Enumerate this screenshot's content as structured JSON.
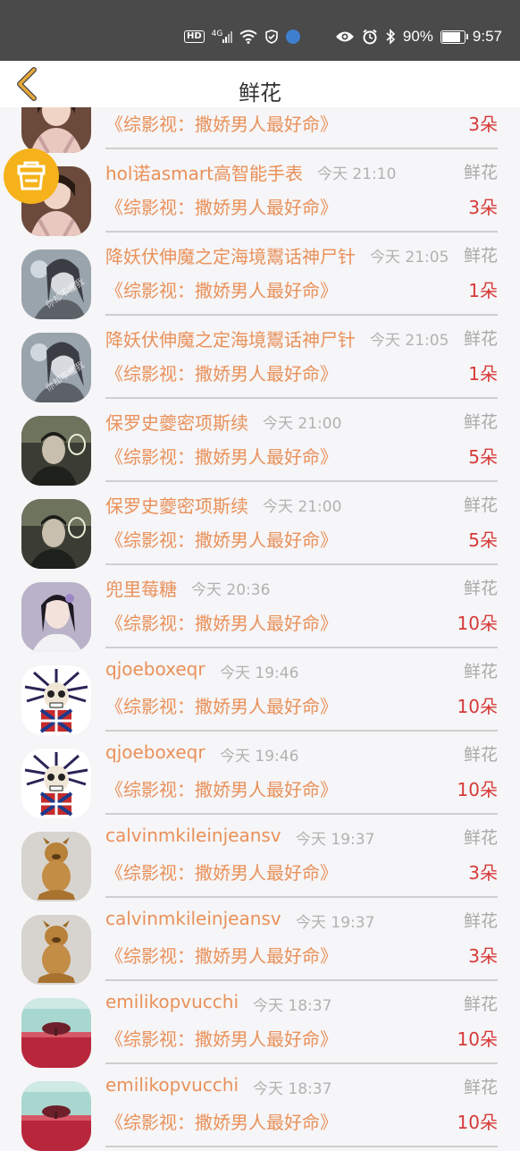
{
  "status_bar": {
    "hd": "HD",
    "network": "4G",
    "battery": "90%",
    "battery_level": 0.9,
    "time": "9:57"
  },
  "header": {
    "title": "鲜花"
  },
  "rows": [
    {
      "name": "",
      "time": "",
      "type": "",
      "work": "《综影视：撒娇男人最好命》",
      "count": "3朵",
      "avatar": "lady-portrait"
    },
    {
      "name": "hol诺asmart高智能手表",
      "time": "今天 21:10",
      "type": "鲜花",
      "work": "《综影视：撒娇男人最好命》",
      "count": "3朵",
      "avatar": "lady-portrait"
    },
    {
      "name": "降妖伏伸魔之定海境鬻话神尸针",
      "time": "今天 21:05",
      "type": "鲜花",
      "work": "《综影视：撒娇男人最好命》",
      "count": "1朵",
      "avatar": "girl-bw"
    },
    {
      "name": "降妖伏伸魔之定海境鬻话神尸针",
      "time": "今天 21:05",
      "type": "鲜花",
      "work": "《综影视：撒娇男人最好命》",
      "count": "1朵",
      "avatar": "girl-bw"
    },
    {
      "name": "保罗史夔密项斯续",
      "time": "今天 21:00",
      "type": "鲜花",
      "work": "《综影视：撒娇男人最好命》",
      "count": "5朵",
      "avatar": "man-dark"
    },
    {
      "name": "保罗史夔密项斯续",
      "time": "今天 21:00",
      "type": "鲜花",
      "work": "《综影视：撒娇男人最好命》",
      "count": "5朵",
      "avatar": "man-dark"
    },
    {
      "name": "兜里莓糖",
      "time": "今天 20:36",
      "type": "鲜花",
      "work": "《综影视：撒娇男人最好命》",
      "count": "10朵",
      "avatar": "woman-costume"
    },
    {
      "name": "qjoeboxeqr",
      "time": "今天 19:46",
      "type": "鲜花",
      "work": "《综影视：撒娇男人最好命》",
      "count": "10朵",
      "avatar": "skull-punk"
    },
    {
      "name": "qjoeboxeqr",
      "time": "今天 19:46",
      "type": "鲜花",
      "work": "《综影视：撒娇男人最好命》",
      "count": "10朵",
      "avatar": "skull-punk"
    },
    {
      "name": "calvinmkileinjeansv",
      "time": "今天 19:37",
      "type": "鲜花",
      "work": "《综影视：撒娇男人最好命》",
      "count": "3朵",
      "avatar": "dog-statue"
    },
    {
      "name": "calvinmkileinjeansv",
      "time": "今天 19:37",
      "type": "鲜花",
      "work": "《综影视：撒娇男人最好命》",
      "count": "3朵",
      "avatar": "dog-statue"
    },
    {
      "name": "emilikopvucchi",
      "time": "今天 18:37",
      "type": "鲜花",
      "work": "《综影视：撒娇男人最好命》",
      "count": "10朵",
      "avatar": "tree-field"
    },
    {
      "name": "emilikopvucchi",
      "time": "今天 18:37",
      "type": "鲜花",
      "work": "《综影视：撒娇男人最好命》",
      "count": "10朵",
      "avatar": "tree-field"
    }
  ],
  "colors": {
    "accent": "#e9915a",
    "count": "#d63a38",
    "float_button": "#f5b21a",
    "back_arrow": "#e7a93a"
  }
}
